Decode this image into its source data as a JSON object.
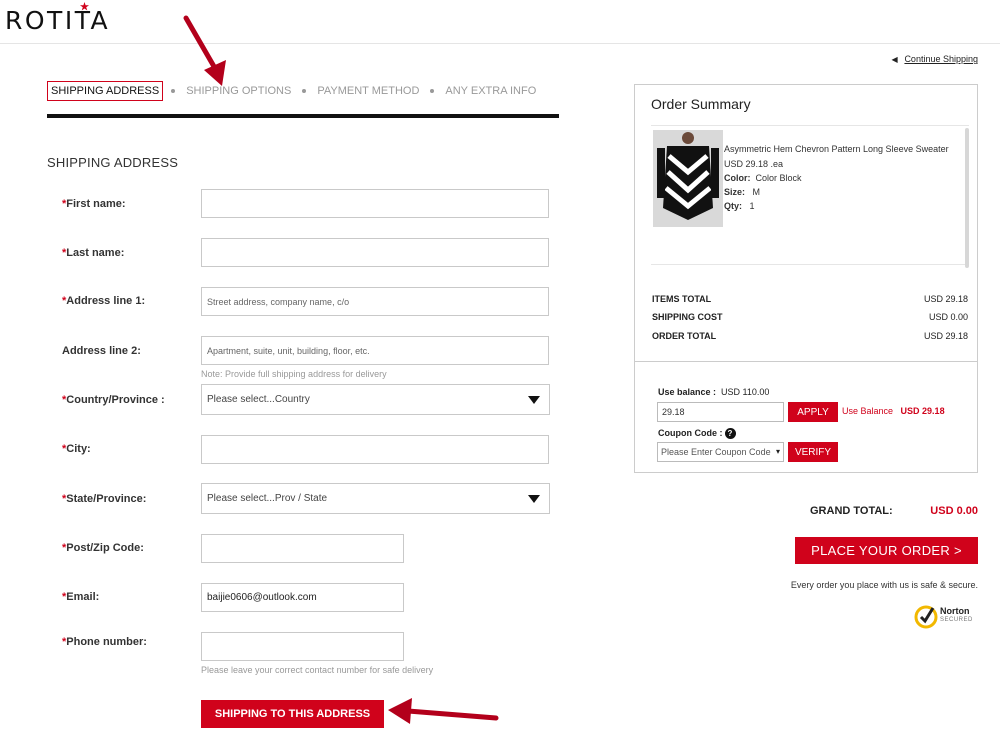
{
  "header": {
    "logo": "ROTITA"
  },
  "nav": {
    "continue_label": "Continue Shipping"
  },
  "steps": [
    {
      "label": "SHIPPING ADDRESS"
    },
    {
      "label": "SHIPPING OPTIONS"
    },
    {
      "label": "PAYMENT METHOD"
    },
    {
      "label": "ANY EXTRA INFO"
    }
  ],
  "form": {
    "title": "SHIPPING ADDRESS",
    "first_name": {
      "label": "First name:",
      "value": ""
    },
    "last_name": {
      "label": "Last name:",
      "value": ""
    },
    "address1": {
      "label": "Address line 1:",
      "placeholder": "Street address, company name, c/o"
    },
    "address2": {
      "label": "Address line 2:",
      "placeholder": "Apartment, suite, unit, building, floor, etc.",
      "note": "Note: Provide full shipping address for delivery"
    },
    "country": {
      "label": "Country/Province :",
      "value": "Please select...Country"
    },
    "city": {
      "label": "City:",
      "value": ""
    },
    "state": {
      "label": "State/Province:",
      "value": "Please select...Prov / State"
    },
    "zip": {
      "label": "Post/Zip Code:",
      "value": ""
    },
    "email": {
      "label": "Email:",
      "value": "baijie0606@outlook.com"
    },
    "phone": {
      "label": "Phone number:",
      "value": "",
      "note": "Please leave your correct contact number for safe delivery"
    },
    "required_mark": "*",
    "submit_label": "SHIPPING TO THIS ADDRESS"
  },
  "summary": {
    "title": "Order Summary",
    "item": {
      "name": "Asymmetric Hem Chevron Pattern Long Sleeve Sweater",
      "price": "USD 29.18 .ea",
      "color_label": "Color:",
      "color": "Color Block",
      "size_label": "Size:",
      "size": "M",
      "qty_label": "Qty:",
      "qty": "1"
    },
    "items_total_label": "ITEMS TOTAL",
    "items_total": "USD 29.18",
    "shipping_label": "SHIPPING COST",
    "shipping": "USD 0.00",
    "order_total_label": "ORDER TOTAL",
    "order_total": "USD 29.18",
    "balance_label": "Use balance :",
    "balance_value": "USD 110.00",
    "balance_input": "29.18",
    "apply_label": "APPLY",
    "use_balance_label": "Use Balance",
    "use_balance_value": "USD 29.18",
    "coupon_label": "Coupon Code :",
    "coupon_placeholder": "Please Enter Coupon Code",
    "verify_label": "VERIFY"
  },
  "checkout": {
    "grand_total_label": "GRAND TOTAL:",
    "grand_total": "USD 0.00",
    "place_order_label": "PLACE YOUR ORDER >",
    "secure_text": "Every order you place with us is safe & secure.",
    "norton_label": "Norton",
    "norton_sub": "SECURED"
  },
  "colors": {
    "accent": "#d0021b",
    "text": "#333333",
    "border": "#c9c9c9"
  },
  "icons": [
    "star-icon",
    "caret-left-icon",
    "dropdown-triangle-icon",
    "question-icon",
    "norton-check-icon",
    "annotation-arrow-icon"
  ]
}
